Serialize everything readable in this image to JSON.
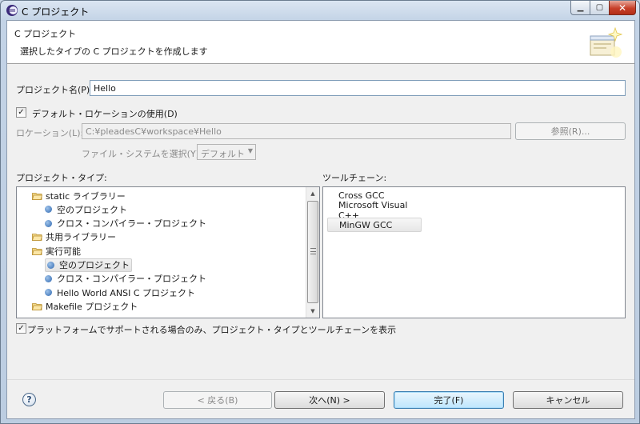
{
  "window": {
    "title": "C プロジェクト",
    "minimize_icon": "minimize-icon",
    "maximize_icon": "maximize-icon",
    "close_icon": "close-icon"
  },
  "banner": {
    "title": "C プロジェクト",
    "description": "選択したタイプの C プロジェクトを作成します"
  },
  "project_name": {
    "label": "プロジェクト名(P):",
    "value": "Hello"
  },
  "default_location": {
    "label": "デフォルト・ロケーションの使用(D)",
    "checked": true
  },
  "location": {
    "label": "ロケーション(L):",
    "value": "C:¥pleadesC¥workspace¥Hello",
    "browse_label": "参照(R)..."
  },
  "filesystem": {
    "label": "ファイル・システムを選択(Y):",
    "selected": "デフォルト"
  },
  "project_types": {
    "header": "プロジェクト・タイプ:",
    "items": [
      {
        "label": "static ライブラリー",
        "kind": "folder"
      },
      {
        "label": "空のプロジェクト",
        "kind": "item"
      },
      {
        "label": "クロス・コンパイラー・プロジェクト",
        "kind": "item"
      },
      {
        "label": "共用ライブラリー",
        "kind": "folder"
      },
      {
        "label": "実行可能",
        "kind": "folder"
      },
      {
        "label": "空のプロジェクト",
        "kind": "item",
        "selected": true
      },
      {
        "label": "クロス・コンパイラー・プロジェクト",
        "kind": "item"
      },
      {
        "label": "Hello World ANSI C プロジェクト",
        "kind": "item"
      },
      {
        "label": "Makefile プロジェクト",
        "kind": "folder"
      }
    ]
  },
  "toolchains": {
    "header": "ツールチェーン:",
    "items": [
      {
        "label": "Cross GCC"
      },
      {
        "label": "Microsoft Visual C++"
      },
      {
        "label": "MinGW GCC",
        "selected": true
      }
    ]
  },
  "filter_checkbox": {
    "label": "プラットフォームでサポートされる場合のみ、プロジェクト・タイプとツールチェーンを表示",
    "checked": true
  },
  "buttons": {
    "back": "< 戻る(B)",
    "next": "次へ(N) >",
    "finish": "完了(F)",
    "cancel": "キャンセル"
  },
  "help": {
    "glyph": "?"
  },
  "colors": {
    "accent": "#3c7fb1",
    "folder": "#e8c25a",
    "bullet": "#2f68b0"
  }
}
